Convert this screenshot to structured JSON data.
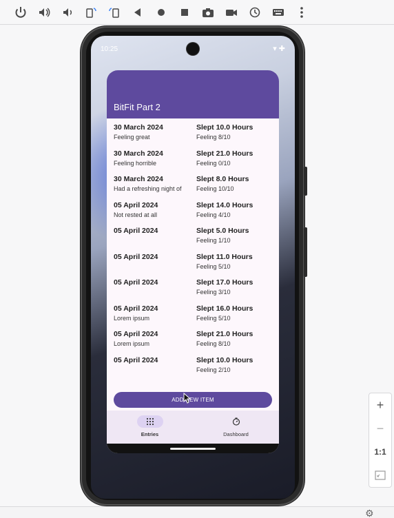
{
  "device": {
    "status_time": "10:25"
  },
  "app": {
    "title": "BitFit Part 2",
    "entries": [
      {
        "date": "30 March 2024",
        "note": "Feeling great",
        "sleep": "Slept 10.0 Hours",
        "feeling": "Feeling 8/10"
      },
      {
        "date": "30 March 2024",
        "note": "Feeling horrible",
        "sleep": "Slept 21.0 Hours",
        "feeling": "Feeling 0/10"
      },
      {
        "date": "30 March 2024",
        "note": "Had a refreshing night of",
        "sleep": "Slept 8.0 Hours",
        "feeling": "Feeling 10/10"
      },
      {
        "date": "05 April 2024",
        "note": "Not rested at all",
        "sleep": "Slept 14.0 Hours",
        "feeling": "Feeling 4/10"
      },
      {
        "date": "05 April 2024",
        "note": "",
        "sleep": "Slept 5.0 Hours",
        "feeling": "Feeling 1/10"
      },
      {
        "date": "05 April 2024",
        "note": "",
        "sleep": "Slept 11.0 Hours",
        "feeling": "Feeling 5/10"
      },
      {
        "date": "05 April 2024",
        "note": "",
        "sleep": "Slept 17.0 Hours",
        "feeling": "Feeling 3/10"
      },
      {
        "date": "05 April 2024",
        "note": "Lorem ipsum",
        "sleep": "Slept 16.0 Hours",
        "feeling": "Feeling 5/10"
      },
      {
        "date": "05 April 2024",
        "note": "Lorem ipsum",
        "sleep": "Slept 21.0 Hours",
        "feeling": "Feeling 8/10"
      },
      {
        "date": "05 April 2024",
        "note": "",
        "sleep": "Slept 10.0 Hours",
        "feeling": "Feeling 2/10"
      }
    ],
    "add_button_label": "ADD NEW ITEM",
    "nav": {
      "entries_label": "Entries",
      "dashboard_label": "Dashboard"
    }
  },
  "zoom": {
    "plus": "+",
    "minus": "−",
    "one_to_one": "1:1"
  },
  "colors": {
    "primary": "#5e4a9e",
    "surface": "#fdf7fc",
    "nav_bg": "#efe7f4",
    "nav_active_pill": "#ddd2f2"
  }
}
